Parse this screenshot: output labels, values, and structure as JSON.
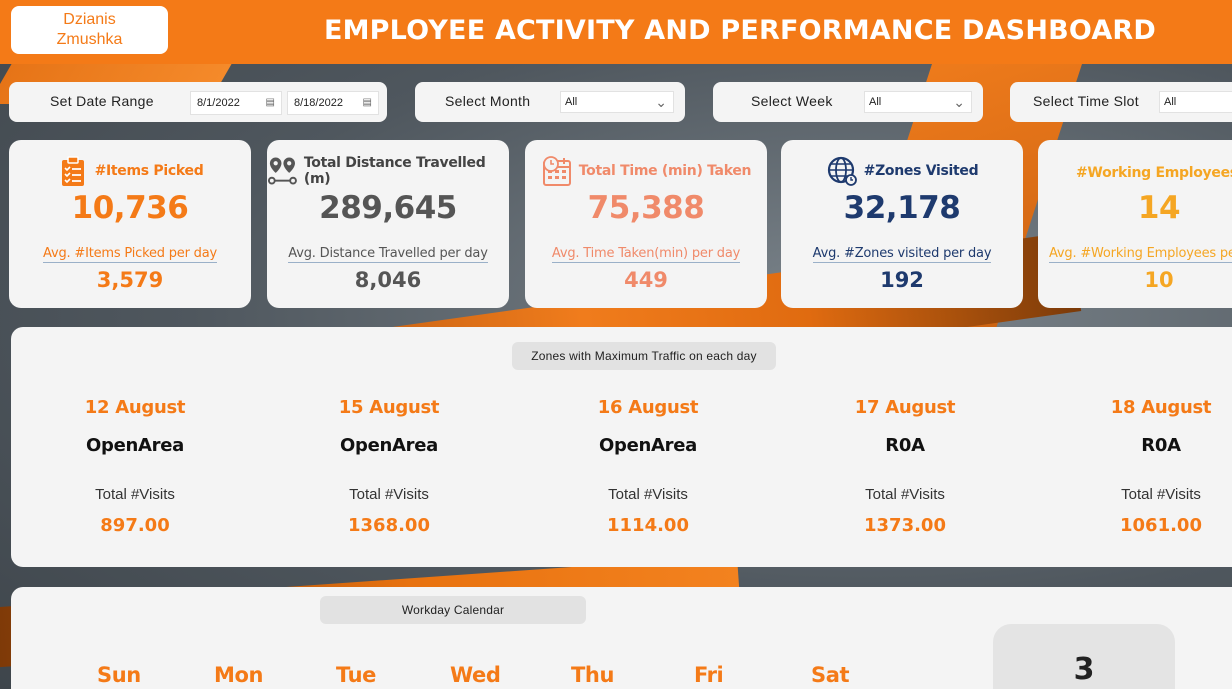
{
  "header": {
    "author_line1": "Dzianis",
    "author_line2": "Zmushka",
    "title": "EMPLOYEE ACTIVITY AND PERFORMANCE DASHBOARD"
  },
  "filters": {
    "date_range": {
      "label": "Set Date Range",
      "start": "8/1/2022",
      "end": "8/18/2022"
    },
    "month": {
      "label": "Select Month",
      "value": "All"
    },
    "week": {
      "label": "Select Week",
      "value": "All"
    },
    "time_slot": {
      "label": "Select Time Slot",
      "value": "All"
    }
  },
  "kpis": [
    {
      "title": "#Items Picked",
      "value": "10,736",
      "sub_label": "Avg. #Items Picked per day",
      "sub_value": "3,579",
      "color": "#f47a17",
      "icon": "clipboard-checklist-icon"
    },
    {
      "title": "Total Distance Travelled (m)",
      "value": "289,645",
      "sub_label": "Avg. Distance Travelled per day",
      "sub_value": "8,046",
      "color": "#555555",
      "icon": "route-pin-icon"
    },
    {
      "title": "Total Time (min) Taken",
      "value": "75,388",
      "sub_label": "Avg. Time Taken(min) per day",
      "sub_value": "449",
      "color": "#f08a6a",
      "icon": "calendar-clock-icon"
    },
    {
      "title": "#Zones Visited",
      "value": "32,178",
      "sub_label": "Avg. #Zones visited per day",
      "sub_value": "192",
      "color": "#1e3a6e",
      "icon": "globe-icon"
    },
    {
      "title": "#Working Employees",
      "value": "14",
      "sub_label": "Avg. #Working Employees per day",
      "sub_value": "10",
      "color": "#f5a623",
      "icon": "employee-icon"
    }
  ],
  "traffic": {
    "title": "Zones with Maximum Traffic on each day",
    "visits_label": "Total #Visits",
    "days": [
      {
        "date": "12 August",
        "zone": "OpenArea",
        "visits": "897.00"
      },
      {
        "date": "15 August",
        "zone": "OpenArea",
        "visits": "1368.00"
      },
      {
        "date": "16 August",
        "zone": "OpenArea",
        "visits": "1114.00"
      },
      {
        "date": "17 August",
        "zone": "R0A",
        "visits": "1373.00"
      },
      {
        "date": "18 August",
        "zone": "R0A",
        "visits": "1061.00"
      }
    ]
  },
  "calendar": {
    "title": "Workday Calendar",
    "weekdays": [
      "Sun",
      "Mon",
      "Tue",
      "Wed",
      "Thu",
      "Fri",
      "Sat"
    ],
    "count": "3"
  }
}
